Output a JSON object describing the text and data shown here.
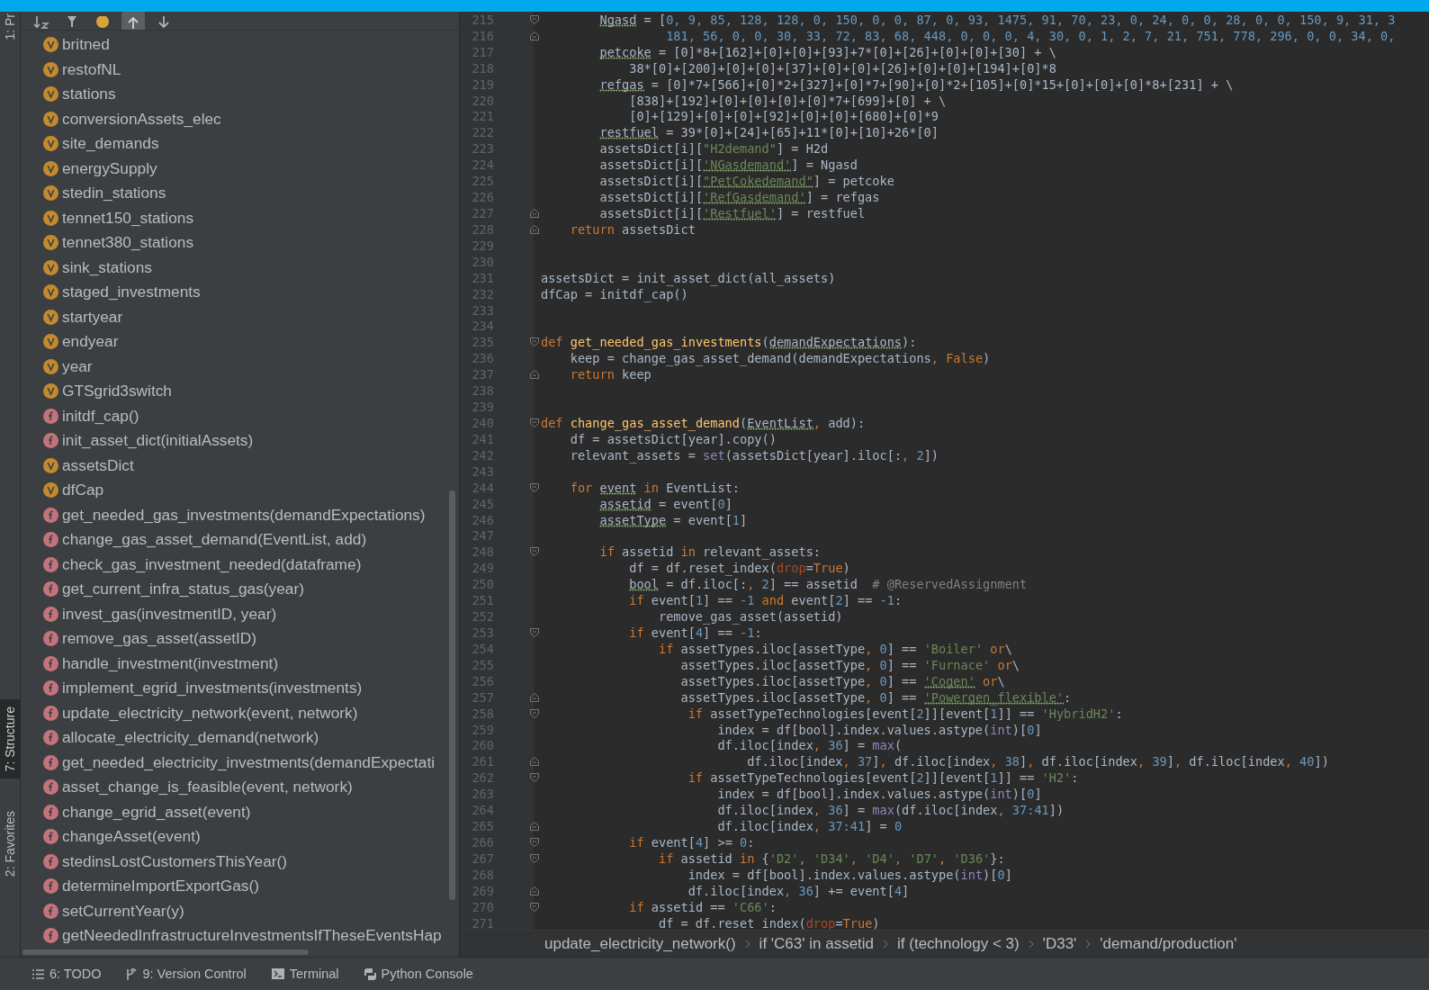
{
  "side_tabs": [
    {
      "label": "1: Pr",
      "selected": false
    },
    {
      "label": "7: Structure",
      "selected": true
    },
    {
      "label": "2: Favorites",
      "selected": false
    }
  ],
  "structure_toolbar": [
    {
      "kind": "sort",
      "selected": false
    },
    {
      "kind": "filter",
      "selected": false
    },
    {
      "kind": "fields",
      "selected": false
    },
    {
      "kind": "expand",
      "selected": true
    },
    {
      "kind": "collapse",
      "selected": false
    }
  ],
  "structure_items": [
    {
      "kind": "variable",
      "label": "britned"
    },
    {
      "kind": "variable",
      "label": "restofNL"
    },
    {
      "kind": "variable",
      "label": "stations"
    },
    {
      "kind": "variable",
      "label": "conversionAssets_elec"
    },
    {
      "kind": "variable",
      "label": "site_demands"
    },
    {
      "kind": "variable",
      "label": "energySupply"
    },
    {
      "kind": "variable",
      "label": "stedin_stations"
    },
    {
      "kind": "variable",
      "label": "tennet150_stations"
    },
    {
      "kind": "variable",
      "label": "tennet380_stations"
    },
    {
      "kind": "variable",
      "label": "sink_stations"
    },
    {
      "kind": "variable",
      "label": "staged_investments"
    },
    {
      "kind": "variable",
      "label": "startyear"
    },
    {
      "kind": "variable",
      "label": "endyear"
    },
    {
      "kind": "variable",
      "label": "year"
    },
    {
      "kind": "variable",
      "label": "GTSgrid3switch"
    },
    {
      "kind": "function",
      "label": "initdf_cap()"
    },
    {
      "kind": "function",
      "label": "init_asset_dict(initialAssets)"
    },
    {
      "kind": "variable",
      "label": "assetsDict"
    },
    {
      "kind": "variable",
      "label": "dfCap"
    },
    {
      "kind": "function",
      "label": "get_needed_gas_investments(demandExpectations)"
    },
    {
      "kind": "function",
      "label": "change_gas_asset_demand(EventList, add)"
    },
    {
      "kind": "function",
      "label": "check_gas_investment_needed(dataframe)"
    },
    {
      "kind": "function",
      "label": "get_current_infra_status_gas(year)"
    },
    {
      "kind": "function",
      "label": "invest_gas(investmentID, year)"
    },
    {
      "kind": "function",
      "label": "remove_gas_asset(assetID)"
    },
    {
      "kind": "function",
      "label": "handle_investment(investment)"
    },
    {
      "kind": "function",
      "label": "implement_egrid_investments(investments)"
    },
    {
      "kind": "function",
      "label": "update_electricity_network(event, network)"
    },
    {
      "kind": "function",
      "label": "allocate_electricity_demand(network)"
    },
    {
      "kind": "function",
      "label": "get_needed_electricity_investments(demandExpectati"
    },
    {
      "kind": "function",
      "label": "asset_change_is_feasible(event, network)"
    },
    {
      "kind": "function",
      "label": "change_egrid_asset(event)"
    },
    {
      "kind": "function",
      "label": "changeAsset(event)"
    },
    {
      "kind": "function",
      "label": "stedinsLostCustomersThisYear()"
    },
    {
      "kind": "function",
      "label": "determineImportExportGas()"
    },
    {
      "kind": "function",
      "label": "setCurrentYear(y)"
    },
    {
      "kind": "function",
      "label": "getNeededInfrastructureInvestmentsIfTheseEventsHap"
    }
  ],
  "code_lines": [
    {
      "number": "215",
      "fold_start": true,
      "fold_end": false,
      "tokens": [
        {
          "kind": "plain",
          "text": "        Ngasd",
          "flagged": true
        },
        {
          "kind": "plain",
          "text": " = [",
          "flagged": false
        },
        {
          "kind": "number",
          "text": "0, 9, 85, 128, 128, 0, 150, 0, 0, 87, 0, 93, 1475, 91, 70, 23, 0, 24, 0, 0, 28, 0, 0, 150, 9, 31, 3",
          "flagged": false
        }
      ]
    },
    {
      "number": "216",
      "fold_start": false,
      "fold_end": true,
      "tokens": [
        {
          "kind": "number",
          "text": "                 181, 56, 0, 0, 30, 33, 72, 83, 68, 448, 0, 0, 0, 4, 30, 0, 1, 2, 7, 21, 751, 778, 296, 0, 0, 34, 0,",
          "flagged": false
        }
      ]
    },
    {
      "number": "217",
      "fold_start": false,
      "fold_end": false,
      "tokens": [
        {
          "kind": "plain",
          "text": "        petcoke",
          "flagged": true
        },
        {
          "kind": "plain",
          "text": " = [0]*8+[162]+[0]+[0]+[93]+7*[0]+[26]+[0]+[0]+[30] + \\",
          "flagged": false
        }
      ]
    },
    {
      "number": "218",
      "fold_start": false,
      "fold_end": false,
      "tokens": [
        {
          "kind": "plain",
          "text": "            38*[0]+[200]+[0]+[0]+[37]+[0]+[0]+[26]+[0]+[0]+[194]+[0]*8",
          "flagged": false
        }
      ]
    },
    {
      "number": "219",
      "fold_start": false,
      "fold_end": false,
      "tokens": [
        {
          "kind": "plain",
          "text": "        refgas",
          "flagged": true
        },
        {
          "kind": "plain",
          "text": " = [0]*7+[566]+[0]*2+[327]+[0]*7+[90]+[0]*2+[105]+[0]*15+[0]+[0]+[0]*8+[231] + \\",
          "flagged": false
        }
      ]
    },
    {
      "number": "220",
      "fold_start": false,
      "fold_end": false,
      "tokens": [
        {
          "kind": "plain",
          "text": "            [838]+[192]+[0]+[0]+[0]+[0]*7+[699]+[0] + \\",
          "flagged": false
        }
      ]
    },
    {
      "number": "221",
      "fold_start": false,
      "fold_end": false,
      "tokens": [
        {
          "kind": "plain",
          "text": "            [0]+[129]+[0]+[0]+[92]+[0]+[0]+[680]+[0]*9",
          "flagged": false
        }
      ]
    },
    {
      "number": "222",
      "fold_start": false,
      "fold_end": false,
      "tokens": [
        {
          "kind": "plain",
          "text": "        restfuel",
          "flagged": true
        },
        {
          "kind": "plain",
          "text": " = 39*[0]+[24]+[65]+11*[0]+[10]+26*[0]",
          "flagged": false
        }
      ]
    },
    {
      "number": "223",
      "fold_start": false,
      "fold_end": false,
      "tokens": [
        {
          "kind": "plain",
          "text": "        assetsDict[i][",
          "flagged": false
        },
        {
          "kind": "string",
          "text": "\"H2demand\"",
          "flagged": false
        },
        {
          "kind": "plain",
          "text": "] = H2d",
          "flagged": false
        }
      ]
    },
    {
      "number": "224",
      "fold_start": false,
      "fold_end": false,
      "tokens": [
        {
          "kind": "plain",
          "text": "        assetsDict[i][",
          "flagged": false
        },
        {
          "kind": "string",
          "text": "'NGasdemand'",
          "flagged": true
        },
        {
          "kind": "plain",
          "text": "] = Ngasd",
          "flagged": false
        }
      ]
    },
    {
      "number": "225",
      "fold_start": false,
      "fold_end": false,
      "tokens": [
        {
          "kind": "plain",
          "text": "        assetsDict[i][",
          "flagged": false
        },
        {
          "kind": "string",
          "text": "\"PetCokedemand\"",
          "flagged": true
        },
        {
          "kind": "plain",
          "text": "] = petcoke",
          "flagged": false
        }
      ]
    },
    {
      "number": "226",
      "fold_start": false,
      "fold_end": false,
      "tokens": [
        {
          "kind": "plain",
          "text": "        assetsDict[i][",
          "flagged": false
        },
        {
          "kind": "string",
          "text": "'RefGasdemand'",
          "flagged": true
        },
        {
          "kind": "plain",
          "text": "] = refgas",
          "flagged": false
        }
      ]
    },
    {
      "number": "227",
      "fold_start": false,
      "fold_end": true,
      "tokens": [
        {
          "kind": "plain",
          "text": "        assetsDict[i][",
          "flagged": false
        },
        {
          "kind": "string",
          "text": "'Restfuel'",
          "flagged": true
        },
        {
          "kind": "plain",
          "text": "] = restfuel",
          "flagged": false
        }
      ]
    },
    {
      "number": "228",
      "fold_start": false,
      "fold_end": true,
      "tokens": [
        {
          "kind": "keyword",
          "text": "    return",
          "flagged": false
        },
        {
          "kind": "plain",
          "text": " assetsDict",
          "flagged": false
        }
      ]
    },
    {
      "number": "229",
      "fold_start": false,
      "fold_end": false
    },
    {
      "number": "230",
      "fold_start": false,
      "fold_end": false
    },
    {
      "number": "231",
      "fold_start": false,
      "fold_end": false,
      "tokens": [
        {
          "kind": "plain",
          "text": "assetsDict = init_asset_dict(all_assets)",
          "flagged": false
        }
      ]
    },
    {
      "number": "232",
      "fold_start": false,
      "fold_end": false,
      "tokens": [
        {
          "kind": "plain",
          "text": "dfCap = initdf_cap()",
          "flagged": false
        }
      ]
    },
    {
      "number": "233",
      "fold_start": false,
      "fold_end": false
    },
    {
      "number": "234",
      "fold_start": false,
      "fold_end": false
    },
    {
      "number": "235",
      "fold_start": true,
      "fold_end": false,
      "tokens": [
        {
          "kind": "keyword",
          "text": "def",
          "flagged": false
        },
        {
          "kind": "function",
          "text": " get_needed_gas_investments",
          "flagged": false
        },
        {
          "kind": "plain",
          "text": "(",
          "flagged": false
        },
        {
          "kind": "plain",
          "text": "demandExpectations",
          "flagged": true
        },
        {
          "kind": "plain",
          "text": "):",
          "flagged": false
        }
      ]
    },
    {
      "number": "236",
      "fold_start": false,
      "fold_end": false,
      "tokens": [
        {
          "kind": "plain",
          "text": "    keep = change_gas_asset_demand(demandExpectations",
          "flagged": false
        },
        {
          "kind": "keyword",
          "text": ", False",
          "flagged": false
        },
        {
          "kind": "plain",
          "text": ")",
          "flagged": false
        }
      ]
    },
    {
      "number": "237",
      "fold_start": false,
      "fold_end": true,
      "tokens": [
        {
          "kind": "keyword",
          "text": "    return",
          "flagged": false
        },
        {
          "kind": "plain",
          "text": " keep",
          "flagged": false
        }
      ]
    },
    {
      "number": "238",
      "fold_start": false,
      "fold_end": false
    },
    {
      "number": "239",
      "fold_start": false,
      "fold_end": false
    },
    {
      "number": "240",
      "fold_start": true,
      "fold_end": false,
      "tokens": [
        {
          "kind": "keyword",
          "text": "def",
          "flagged": false
        },
        {
          "kind": "function",
          "text": " change_gas_asset_demand",
          "flagged": false
        },
        {
          "kind": "plain",
          "text": "(",
          "flagged": false
        },
        {
          "kind": "plain",
          "text": "EventList",
          "flagged": true
        },
        {
          "kind": "keyword",
          "text": ",",
          "flagged": false
        },
        {
          "kind": "plain",
          "text": " add):",
          "flagged": false
        }
      ]
    },
    {
      "number": "241",
      "fold_start": false,
      "fold_end": false,
      "tokens": [
        {
          "kind": "plain",
          "text": "    df = assetsDict[year].copy()",
          "flagged": false
        }
      ]
    },
    {
      "number": "242",
      "fold_start": false,
      "fold_end": false,
      "tokens": [
        {
          "kind": "plain",
          "text": "    relevant_assets = ",
          "flagged": false
        },
        {
          "kind": "builtin",
          "text": "set",
          "flagged": false
        },
        {
          "kind": "plain",
          "text": "(assetsDict[year].iloc[:",
          "flagged": false
        },
        {
          "kind": "keyword",
          "text": ",",
          "flagged": false
        },
        {
          "kind": "number",
          "text": " 2",
          "flagged": false
        },
        {
          "kind": "plain",
          "text": "])",
          "flagged": false
        }
      ]
    },
    {
      "number": "243",
      "fold_start": false,
      "fold_end": false
    },
    {
      "number": "244",
      "fold_start": true,
      "fold_end": false,
      "tokens": [
        {
          "kind": "keyword",
          "text": "    for",
          "flagged": false
        },
        {
          "kind": "plain",
          "text": " event",
          "flagged": true
        },
        {
          "kind": "keyword",
          "text": " in",
          "flagged": false
        },
        {
          "kind": "plain",
          "text": " EventList:",
          "flagged": false
        }
      ]
    },
    {
      "number": "245",
      "fold_start": false,
      "fold_end": false,
      "tokens": [
        {
          "kind": "plain",
          "text": "        assetid",
          "flagged": true
        },
        {
          "kind": "plain",
          "text": " = event[",
          "flagged": false
        },
        {
          "kind": "number",
          "text": "0",
          "flagged": false
        },
        {
          "kind": "plain",
          "text": "]",
          "flagged": false
        }
      ]
    },
    {
      "number": "246",
      "fold_start": false,
      "fold_end": false,
      "tokens": [
        {
          "kind": "plain",
          "text": "        assetType",
          "flagged": true
        },
        {
          "kind": "plain",
          "text": " = event[",
          "flagged": false
        },
        {
          "kind": "number",
          "text": "1",
          "flagged": false
        },
        {
          "kind": "plain",
          "text": "]",
          "flagged": false
        }
      ]
    },
    {
      "number": "247",
      "fold_start": false,
      "fold_end": false
    },
    {
      "number": "248",
      "fold_start": true,
      "fold_end": false,
      "tokens": [
        {
          "kind": "keyword",
          "text": "        if",
          "flagged": false
        },
        {
          "kind": "plain",
          "text": " assetid",
          "flagged": false
        },
        {
          "kind": "keyword",
          "text": " in",
          "flagged": false
        },
        {
          "kind": "plain",
          "text": " relevant_assets:",
          "flagged": false
        }
      ]
    },
    {
      "number": "249",
      "fold_start": false,
      "fold_end": false,
      "tokens": [
        {
          "kind": "plain",
          "text": "            df = df.reset_index(",
          "flagged": false
        },
        {
          "kind": "argument",
          "text": "drop",
          "flagged": false
        },
        {
          "kind": "plain",
          "text": "=",
          "flagged": false
        },
        {
          "kind": "keyword",
          "text": "True",
          "flagged": false
        },
        {
          "kind": "plain",
          "text": ")",
          "flagged": false
        }
      ]
    },
    {
      "number": "250",
      "fold_start": false,
      "fold_end": false,
      "tokens": [
        {
          "kind": "plain",
          "text": "            bool",
          "flagged": true
        },
        {
          "kind": "plain",
          "text": " = df.iloc[:",
          "flagged": false
        },
        {
          "kind": "keyword",
          "text": ",",
          "flagged": false
        },
        {
          "kind": "number",
          "text": " 2",
          "flagged": false
        },
        {
          "kind": "plain",
          "text": "] == assetid",
          "flagged": false
        },
        {
          "kind": "comment",
          "text": "  # @ReservedAssignment",
          "flagged": false
        }
      ]
    },
    {
      "number": "251",
      "fold_start": false,
      "fold_end": false,
      "tokens": [
        {
          "kind": "keyword",
          "text": "            if",
          "flagged": false
        },
        {
          "kind": "plain",
          "text": " event[",
          "flagged": false
        },
        {
          "kind": "number",
          "text": "1",
          "flagged": false
        },
        {
          "kind": "plain",
          "text": "] ==",
          "flagged": false
        },
        {
          "kind": "number",
          "text": " -1",
          "flagged": false
        },
        {
          "kind": "keyword",
          "text": " and",
          "flagged": false
        },
        {
          "kind": "plain",
          "text": " event[",
          "flagged": false
        },
        {
          "kind": "number",
          "text": "2",
          "flagged": false
        },
        {
          "kind": "plain",
          "text": "] ==",
          "flagged": false
        },
        {
          "kind": "number",
          "text": " -1",
          "flagged": false
        },
        {
          "kind": "plain",
          "text": ":",
          "flagged": false
        }
      ]
    },
    {
      "number": "252",
      "fold_start": false,
      "fold_end": false,
      "tokens": [
        {
          "kind": "plain",
          "text": "                remove_gas_asset(assetid)",
          "flagged": false
        }
      ]
    },
    {
      "number": "253",
      "fold_start": true,
      "fold_end": false,
      "tokens": [
        {
          "kind": "keyword",
          "text": "            if",
          "flagged": false
        },
        {
          "kind": "plain",
          "text": " event[",
          "flagged": false
        },
        {
          "kind": "number",
          "text": "4",
          "flagged": false
        },
        {
          "kind": "plain",
          "text": "] ==",
          "flagged": false
        },
        {
          "kind": "number",
          "text": " -1",
          "flagged": false
        },
        {
          "kind": "plain",
          "text": ":",
          "flagged": false
        }
      ]
    },
    {
      "number": "254",
      "fold_start": false,
      "fold_end": false,
      "tokens": [
        {
          "kind": "keyword",
          "text": "                if",
          "flagged": false
        },
        {
          "kind": "plain",
          "text": " assetTypes.iloc[assetType",
          "flagged": false
        },
        {
          "kind": "keyword",
          "text": ",",
          "flagged": false
        },
        {
          "kind": "number",
          "text": " 0",
          "flagged": false
        },
        {
          "kind": "plain",
          "text": "] ==",
          "flagged": false
        },
        {
          "kind": "string",
          "text": " 'Boiler'",
          "flagged": false
        },
        {
          "kind": "keyword",
          "text": " or",
          "flagged": false
        },
        {
          "kind": "plain",
          "text": "\\",
          "flagged": false
        }
      ]
    },
    {
      "number": "255",
      "fold_start": false,
      "fold_end": false,
      "tokens": [
        {
          "kind": "plain",
          "text": "                   assetTypes.iloc[assetType",
          "flagged": false
        },
        {
          "kind": "keyword",
          "text": ",",
          "flagged": false
        },
        {
          "kind": "number",
          "text": " 0",
          "flagged": false
        },
        {
          "kind": "plain",
          "text": "] ==",
          "flagged": false
        },
        {
          "kind": "string",
          "text": " 'Furnace'",
          "flagged": false
        },
        {
          "kind": "keyword",
          "text": " or",
          "flagged": false
        },
        {
          "kind": "plain",
          "text": "\\",
          "flagged": false
        }
      ]
    },
    {
      "number": "256",
      "fold_start": false,
      "fold_end": false,
      "tokens": [
        {
          "kind": "plain",
          "text": "                   assetTypes.iloc[assetType",
          "flagged": false
        },
        {
          "kind": "keyword",
          "text": ",",
          "flagged": false
        },
        {
          "kind": "number",
          "text": " 0",
          "flagged": false
        },
        {
          "kind": "plain",
          "text": "] ==",
          "flagged": false
        },
        {
          "kind": "string",
          "text": " 'Cogen'",
          "flagged": true
        },
        {
          "kind": "keyword",
          "text": " or",
          "flagged": false
        },
        {
          "kind": "plain",
          "text": "\\",
          "flagged": false
        }
      ]
    },
    {
      "number": "257",
      "fold_start": false,
      "fold_end": true,
      "tokens": [
        {
          "kind": "plain",
          "text": "                   assetTypes.iloc[assetType",
          "flagged": false
        },
        {
          "kind": "keyword",
          "text": ",",
          "flagged": false
        },
        {
          "kind": "number",
          "text": " 0",
          "flagged": false
        },
        {
          "kind": "plain",
          "text": "] ==",
          "flagged": false
        },
        {
          "kind": "string",
          "text": " 'Powergen_flexible'",
          "flagged": true
        },
        {
          "kind": "plain",
          "text": ":",
          "flagged": false
        }
      ]
    },
    {
      "number": "258",
      "fold_start": true,
      "fold_end": false,
      "tokens": [
        {
          "kind": "keyword",
          "text": "                    if",
          "flagged": false
        },
        {
          "kind": "plain",
          "text": " assetTypeTechnologies[event[",
          "flagged": false
        },
        {
          "kind": "number",
          "text": "2",
          "flagged": false
        },
        {
          "kind": "plain",
          "text": "]][event[",
          "flagged": false
        },
        {
          "kind": "number",
          "text": "1",
          "flagged": false
        },
        {
          "kind": "plain",
          "text": "]] ==",
          "flagged": false
        },
        {
          "kind": "string",
          "text": " 'HybridH2'",
          "flagged": false
        },
        {
          "kind": "plain",
          "text": ":",
          "flagged": false
        }
      ]
    },
    {
      "number": "259",
      "fold_start": false,
      "fold_end": false,
      "tokens": [
        {
          "kind": "plain",
          "text": "                        index = df[bool].index.values.astype(",
          "flagged": false
        },
        {
          "kind": "builtin",
          "text": "int",
          "flagged": false
        },
        {
          "kind": "plain",
          "text": ")[",
          "flagged": false
        },
        {
          "kind": "number",
          "text": "0",
          "flagged": false
        },
        {
          "kind": "plain",
          "text": "]",
          "flagged": false
        }
      ]
    },
    {
      "number": "260",
      "fold_start": false,
      "fold_end": false,
      "tokens": [
        {
          "kind": "plain",
          "text": "                        df.iloc[index",
          "flagged": false
        },
        {
          "kind": "keyword",
          "text": ",",
          "flagged": false
        },
        {
          "kind": "number",
          "text": " 36",
          "flagged": false
        },
        {
          "kind": "plain",
          "text": "] =",
          "flagged": false
        },
        {
          "kind": "builtin",
          "text": " max",
          "flagged": false
        },
        {
          "kind": "plain",
          "text": "(",
          "flagged": false
        }
      ]
    },
    {
      "number": "261",
      "fold_start": false,
      "fold_end": true,
      "tokens": [
        {
          "kind": "plain",
          "text": "                            df.iloc[index",
          "flagged": false
        },
        {
          "kind": "keyword",
          "text": ",",
          "flagged": false
        },
        {
          "kind": "number",
          "text": " 37",
          "flagged": false
        },
        {
          "kind": "plain",
          "text": "]",
          "flagged": false
        },
        {
          "kind": "keyword",
          "text": ",",
          "flagged": false
        },
        {
          "kind": "plain",
          "text": " df.iloc[index",
          "flagged": false
        },
        {
          "kind": "keyword",
          "text": ",",
          "flagged": false
        },
        {
          "kind": "number",
          "text": " 38",
          "flagged": false
        },
        {
          "kind": "plain",
          "text": "]",
          "flagged": false
        },
        {
          "kind": "keyword",
          "text": ",",
          "flagged": false
        },
        {
          "kind": "plain",
          "text": " df.iloc[index",
          "flagged": false
        },
        {
          "kind": "keyword",
          "text": ",",
          "flagged": false
        },
        {
          "kind": "number",
          "text": " 39",
          "flagged": false
        },
        {
          "kind": "plain",
          "text": "]",
          "flagged": false
        },
        {
          "kind": "keyword",
          "text": ",",
          "flagged": false
        },
        {
          "kind": "plain",
          "text": " df.iloc[index",
          "flagged": false
        },
        {
          "kind": "keyword",
          "text": ",",
          "flagged": false
        },
        {
          "kind": "number",
          "text": " 40",
          "flagged": false
        },
        {
          "kind": "plain",
          "text": "])",
          "flagged": false
        }
      ]
    },
    {
      "number": "262",
      "fold_start": true,
      "fold_end": false,
      "tokens": [
        {
          "kind": "keyword",
          "text": "                    if",
          "flagged": false
        },
        {
          "kind": "plain",
          "text": " assetTypeTechnologies[event[",
          "flagged": false
        },
        {
          "kind": "number",
          "text": "2",
          "flagged": false
        },
        {
          "kind": "plain",
          "text": "]][event[",
          "flagged": false
        },
        {
          "kind": "number",
          "text": "1",
          "flagged": false
        },
        {
          "kind": "plain",
          "text": "]] ==",
          "flagged": false
        },
        {
          "kind": "string",
          "text": " 'H2'",
          "flagged": false
        },
        {
          "kind": "plain",
          "text": ":",
          "flagged": false
        }
      ]
    },
    {
      "number": "263",
      "fold_start": false,
      "fold_end": false,
      "tokens": [
        {
          "kind": "plain",
          "text": "                        index = df[bool].index.values.astype(",
          "flagged": false
        },
        {
          "kind": "builtin",
          "text": "int",
          "flagged": false
        },
        {
          "kind": "plain",
          "text": ")[",
          "flagged": false
        },
        {
          "kind": "number",
          "text": "0",
          "flagged": false
        },
        {
          "kind": "plain",
          "text": "]",
          "flagged": false
        }
      ]
    },
    {
      "number": "264",
      "fold_start": false,
      "fold_end": false,
      "tokens": [
        {
          "kind": "plain",
          "text": "                        df.iloc[index",
          "flagged": false
        },
        {
          "kind": "keyword",
          "text": ",",
          "flagged": false
        },
        {
          "kind": "number",
          "text": " 36",
          "flagged": false
        },
        {
          "kind": "plain",
          "text": "] =",
          "flagged": false
        },
        {
          "kind": "builtin",
          "text": " max",
          "flagged": false
        },
        {
          "kind": "plain",
          "text": "(df.iloc[index",
          "flagged": false
        },
        {
          "kind": "keyword",
          "text": ",",
          "flagged": false
        },
        {
          "kind": "number",
          "text": " 37:41",
          "flagged": false
        },
        {
          "kind": "plain",
          "text": "])",
          "flagged": false
        }
      ]
    },
    {
      "number": "265",
      "fold_start": false,
      "fold_end": true,
      "tokens": [
        {
          "kind": "plain",
          "text": "                        df.iloc[index",
          "flagged": false
        },
        {
          "kind": "keyword",
          "text": ",",
          "flagged": false
        },
        {
          "kind": "number",
          "text": " 37:41",
          "flagged": false
        },
        {
          "kind": "plain",
          "text": "] =",
          "flagged": false
        },
        {
          "kind": "number",
          "text": " 0",
          "flagged": false
        }
      ]
    },
    {
      "number": "266",
      "fold_start": true,
      "fold_end": false,
      "tokens": [
        {
          "kind": "keyword",
          "text": "            if",
          "flagged": false
        },
        {
          "kind": "plain",
          "text": " event[",
          "flagged": false
        },
        {
          "kind": "number",
          "text": "4",
          "flagged": false
        },
        {
          "kind": "plain",
          "text": "] >=",
          "flagged": false
        },
        {
          "kind": "number",
          "text": " 0",
          "flagged": false
        },
        {
          "kind": "plain",
          "text": ":",
          "flagged": false
        }
      ]
    },
    {
      "number": "267",
      "fold_start": true,
      "fold_end": false,
      "tokens": [
        {
          "kind": "keyword",
          "text": "                if",
          "flagged": false
        },
        {
          "kind": "plain",
          "text": " assetid",
          "flagged": false
        },
        {
          "kind": "keyword",
          "text": " in",
          "flagged": false
        },
        {
          "kind": "plain",
          "text": " {",
          "flagged": false
        },
        {
          "kind": "string",
          "text": "'D2'",
          "flagged": false
        },
        {
          "kind": "keyword",
          "text": ",",
          "flagged": false
        },
        {
          "kind": "string",
          "text": " 'D34'",
          "flagged": false
        },
        {
          "kind": "keyword",
          "text": ",",
          "flagged": false
        },
        {
          "kind": "string",
          "text": " 'D4'",
          "flagged": false
        },
        {
          "kind": "keyword",
          "text": ",",
          "flagged": false
        },
        {
          "kind": "string",
          "text": " 'D7'",
          "flagged": false
        },
        {
          "kind": "keyword",
          "text": ",",
          "flagged": false
        },
        {
          "kind": "string",
          "text": " 'D36'",
          "flagged": false
        },
        {
          "kind": "plain",
          "text": "}:",
          "flagged": false
        }
      ]
    },
    {
      "number": "268",
      "fold_start": false,
      "fold_end": false,
      "tokens": [
        {
          "kind": "plain",
          "text": "                    index = df[bool].index.values.astype(",
          "flagged": false
        },
        {
          "kind": "builtin",
          "text": "int",
          "flagged": false
        },
        {
          "kind": "plain",
          "text": ")[",
          "flagged": false
        },
        {
          "kind": "number",
          "text": "0",
          "flagged": false
        },
        {
          "kind": "plain",
          "text": "]",
          "flagged": false
        }
      ]
    },
    {
      "number": "269",
      "fold_start": false,
      "fold_end": true,
      "tokens": [
        {
          "kind": "plain",
          "text": "                    df.iloc[index",
          "flagged": false
        },
        {
          "kind": "keyword",
          "text": ",",
          "flagged": false
        },
        {
          "kind": "number",
          "text": " 36",
          "flagged": false
        },
        {
          "kind": "plain",
          "text": "] += event[",
          "flagged": false
        },
        {
          "kind": "number",
          "text": "4",
          "flagged": false
        },
        {
          "kind": "plain",
          "text": "]",
          "flagged": false
        }
      ]
    },
    {
      "number": "270",
      "fold_start": true,
      "fold_end": false,
      "tokens": [
        {
          "kind": "keyword",
          "text": "            if",
          "flagged": false
        },
        {
          "kind": "plain",
          "text": " assetid ==",
          "flagged": false
        },
        {
          "kind": "string",
          "text": " 'C66'",
          "flagged": false
        },
        {
          "kind": "plain",
          "text": ":",
          "flagged": false
        }
      ]
    },
    {
      "number": "271",
      "fold_start": false,
      "fold_end": false,
      "tokens": [
        {
          "kind": "plain",
          "text": "                df = df.reset_index(",
          "flagged": false
        },
        {
          "kind": "argument",
          "text": "drop",
          "flagged": false
        },
        {
          "kind": "plain",
          "text": "=",
          "flagged": false
        },
        {
          "kind": "keyword",
          "text": "True",
          "flagged": false
        },
        {
          "kind": "plain",
          "text": ")",
          "flagged": false
        }
      ]
    }
  ],
  "breadcrumbs": [
    "update_electricity_network()",
    "if 'C63' in assetid",
    "if (technology < 3)",
    "'D33'",
    "'demand/production'"
  ],
  "bottom_tools": [
    {
      "kind": "todo",
      "label": "6: TODO"
    },
    {
      "kind": "vcs",
      "label": "9: Version Control"
    },
    {
      "kind": "terminal",
      "label": "Terminal"
    },
    {
      "kind": "python",
      "label": "Python Console"
    }
  ]
}
